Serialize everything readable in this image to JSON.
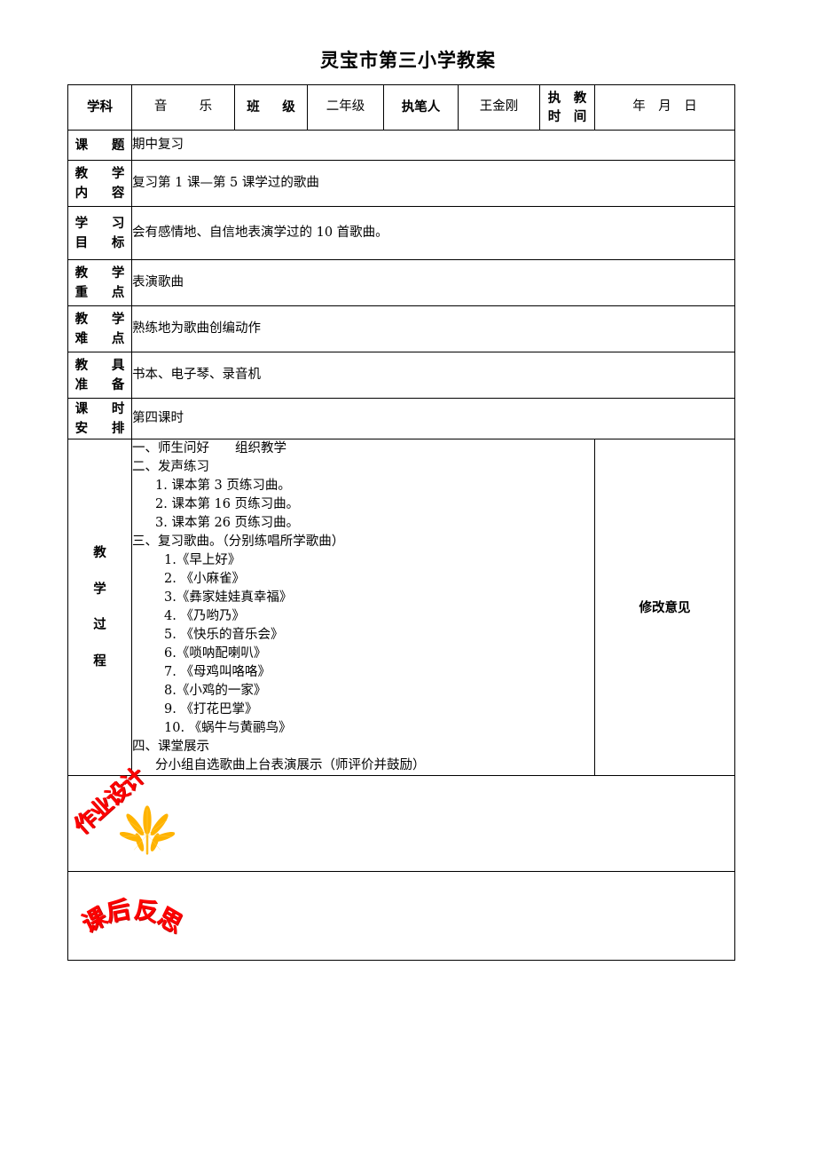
{
  "document": {
    "title": "灵宝市第三小学教案"
  },
  "header_row": {
    "subject_label": "学科",
    "subject_value": "音　乐",
    "class_label": "班　级",
    "class_value": "二年级",
    "author_label": "执笔人",
    "author_value": "王金刚",
    "teach_time_label_line1": "执　教",
    "teach_time_label_line2": "时　间",
    "teach_time_value": "年　月　日"
  },
  "info_rows": [
    {
      "label_line1": "课　题",
      "label_line2": "",
      "value": "期中复习"
    },
    {
      "label_line1": "教　学",
      "label_line2": "内　容",
      "value": "复习第 1 课—第 5 课学过的歌曲"
    },
    {
      "label_line1": "学　习",
      "label_line2": "目　标",
      "value": "会有感情地、自信地表演学过的 10 首歌曲。"
    },
    {
      "label_line1": "教　学",
      "label_line2": "重　点",
      "value": "表演歌曲"
    },
    {
      "label_line1": "教　学",
      "label_line2": "难　点",
      "value": "熟练地为歌曲创编动作"
    },
    {
      "label_line1": "教　具",
      "label_line2": "准　备",
      "value": "书本、电子琴、录音机"
    },
    {
      "label_line1": "课　时",
      "label_line2": "安　排",
      "value": "第四课时"
    }
  ],
  "process": {
    "vertical_label": [
      "教",
      "学",
      "过",
      "程"
    ],
    "opinion_header": "修改意见",
    "lines": [
      {
        "text": "一、师生问好　　组织教学",
        "indent": 0
      },
      {
        "text": "二、发声练习",
        "indent": 0
      },
      {
        "text": "1. 课本第 3 页练习曲。",
        "indent": 1
      },
      {
        "text": "2. 课本第 16 页练习曲。",
        "indent": 1
      },
      {
        "text": "3. 课本第 26 页练习曲。",
        "indent": 1
      },
      {
        "text": "三、复习歌曲。（分别练唱所学歌曲）",
        "indent": 0
      },
      {
        "text": "1.《早上好》",
        "indent": 2
      },
      {
        "text": "2. 《小麻雀》",
        "indent": 2
      },
      {
        "text": "3.《彝家娃娃真幸福》",
        "indent": 2
      },
      {
        "text": "4. 《乃哟乃》",
        "indent": 2
      },
      {
        "text": "5. 《快乐的音乐会》",
        "indent": 2
      },
      {
        "text": "6.《唢呐配喇叭》",
        "indent": 2
      },
      {
        "text": "7. 《母鸡叫咯咯》",
        "indent": 2
      },
      {
        "text": "8.《小鸡的一家》",
        "indent": 2
      },
      {
        "text": "9. 《打花巴掌》",
        "indent": 2
      },
      {
        "text": "10. 《蜗牛与黄鹂鸟》",
        "indent": 2
      },
      {
        "text": "四、课堂展示",
        "indent": 0
      },
      {
        "text": "分小组自选歌曲上台表演展示（师评价并鼓励）",
        "indent": 1
      }
    ]
  },
  "stamps": {
    "homework": {
      "text": "作业设计",
      "color": "#ff0000",
      "leaf_icon": "maple-leaf-icon",
      "leaf_color": "#ffb300"
    },
    "reflection": {
      "text": "课后反思",
      "chars": [
        "课",
        "后",
        "反",
        "思"
      ],
      "color": "#ff0000"
    }
  }
}
